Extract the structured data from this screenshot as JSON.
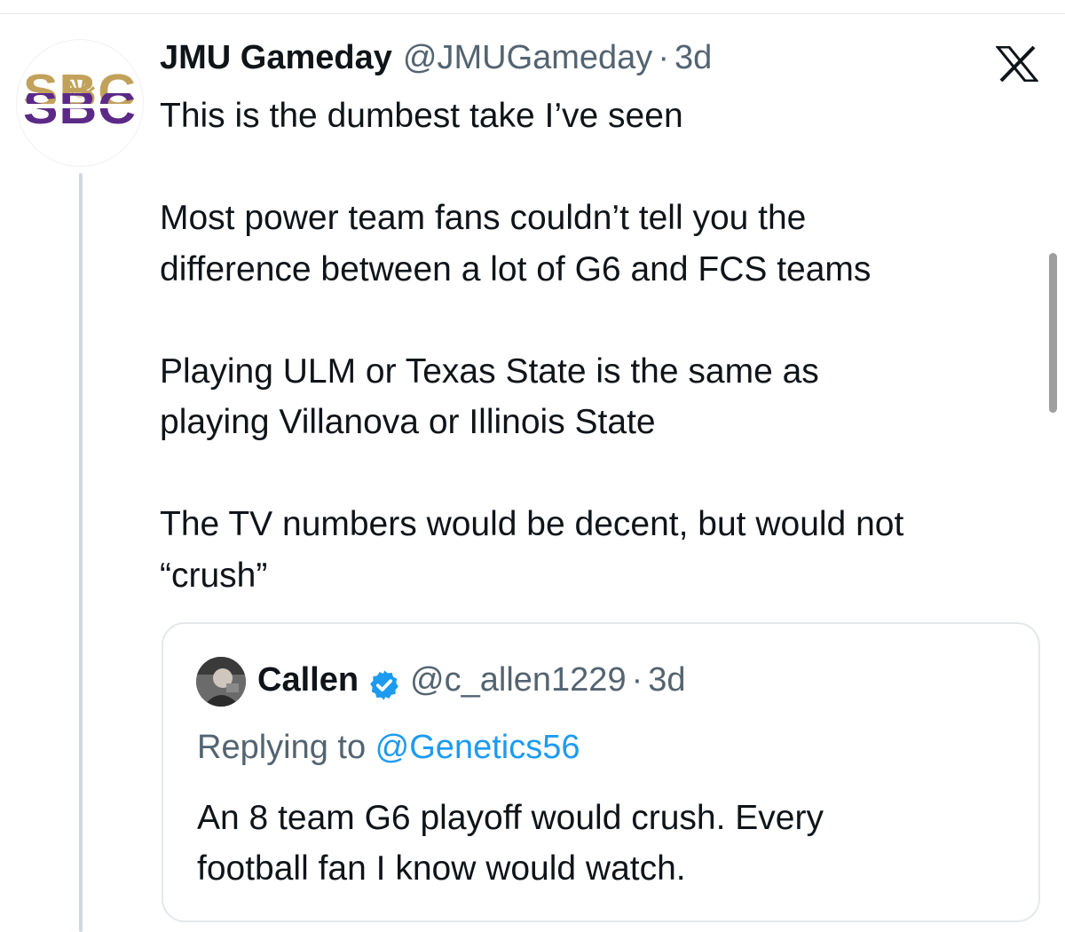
{
  "tweet": {
    "display_name": "JMU Gameday",
    "handle": "@JMUGameday",
    "separator": "·",
    "time": "3d",
    "avatar_logo_text": "SBC",
    "lines": [
      "This is the dumbest take I’ve seen",
      "",
      "Most power team fans couldn’t tell you the",
      "difference between a lot of G6 and FCS teams",
      "",
      "Playing ULM or Texas State is the same as",
      "playing Villanova or Illinois State",
      "",
      "The TV numbers would be decent, but would not",
      "“crush”"
    ]
  },
  "quoted": {
    "display_name": "Callen",
    "handle": "@c_allen1229",
    "separator": "·",
    "time": "3d",
    "verified": true,
    "replying_prefix": "Replying to ",
    "replying_to": "@Genetics56",
    "lines": [
      "An 8 team G6 playoff would crush. Every",
      "football fan I know would watch."
    ]
  },
  "icons": {
    "brand": "x-logo-icon",
    "verified": "verified-badge-icon"
  },
  "colors": {
    "text": "#0f1419",
    "secondary": "#536471",
    "link": "#1d9bf0",
    "verified": "#1d9bf0",
    "logo_gold": "#c2a15b",
    "logo_purple": "#5b2a86"
  }
}
